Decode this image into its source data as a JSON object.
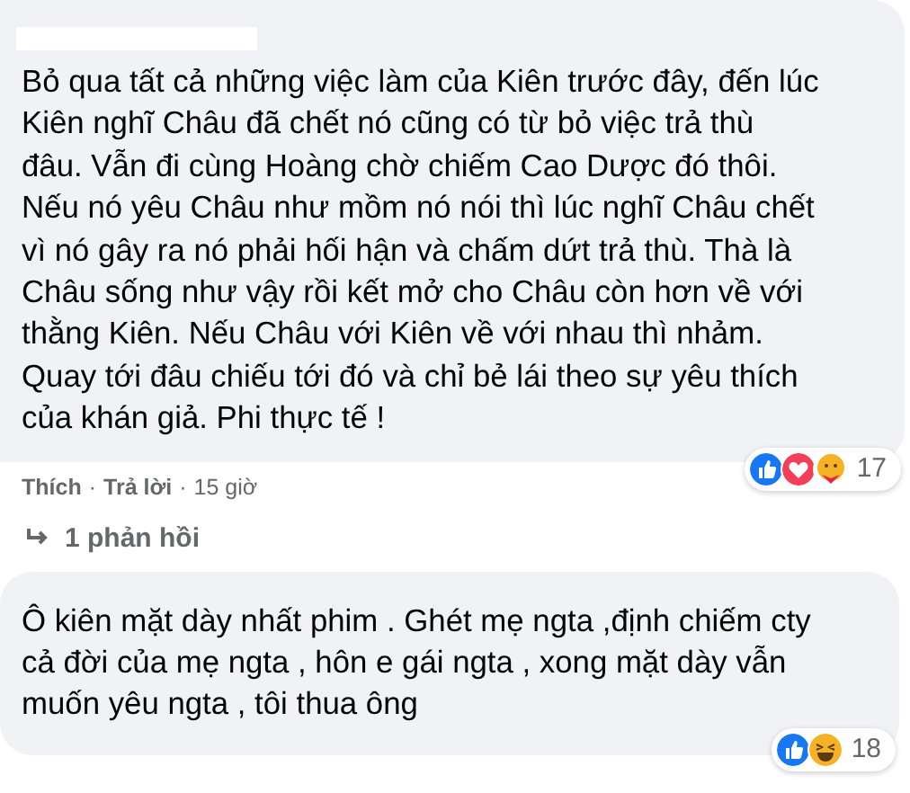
{
  "comments": [
    {
      "text": "Bỏ qua tất cả những việc làm của Kiên trước đây, đến lúc\nKiên nghĩ Châu đã chết nó cũng có từ bỏ việc trả thù\nđâu. Vẫn đi cùng Hoàng chờ chiếm Cao Dược đó thôi.\nNếu nó yêu Châu như mồm nó nói thì lúc nghĩ Châu chết\nvì nó gây ra nó phải hối hận và chấm dứt trả thù. Thà là\nChâu sống như vậy rồi kết mở cho Châu còn hơn về với\nthằng Kiên. Nếu Châu với Kiên về với nhau thì nhảm.\nQuay tới đâu chiếu tới đó và chỉ bẻ lái theo sự yêu thích\ncủa khán giả. Phi thực tế !",
      "name_hidden": true,
      "reaction_count": "17",
      "reactions": [
        {
          "kind": "like"
        },
        {
          "kind": "love"
        },
        {
          "kind": "care"
        }
      ],
      "actions": {
        "like": "Thích",
        "separator": "·",
        "reply": "Trả lời",
        "time": "15 giờ"
      },
      "replies_link": "1 phản hồi"
    },
    {
      "text": "Ô kiên mặt dày nhất phim . Ghét mẹ ngta ,định chiếm cty\ncả đời của mẹ ngta , hôn e gái ngta , xong mặt dày vẫn\nmuốn yêu ngta , tôi thua ông",
      "name_hidden": false,
      "reaction_count": "18",
      "reactions": [
        {
          "kind": "like"
        },
        {
          "kind": "haha"
        }
      ]
    }
  ]
}
